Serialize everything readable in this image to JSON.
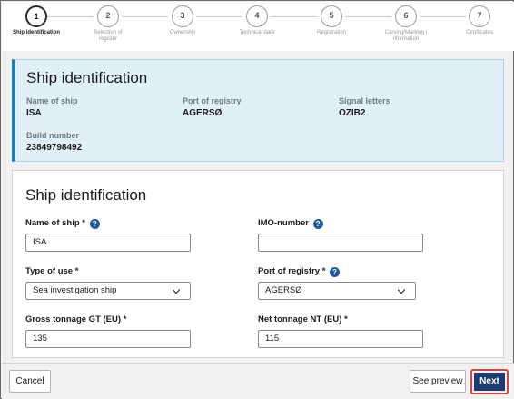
{
  "stepper": {
    "steps": [
      {
        "number": "1",
        "label": "Ship identification"
      },
      {
        "number": "2",
        "label": "Selection of register"
      },
      {
        "number": "3",
        "label": "Ownership"
      },
      {
        "number": "4",
        "label": "Technical data"
      },
      {
        "number": "5",
        "label": "Registration"
      },
      {
        "number": "6",
        "label": "Carving/Marking information"
      },
      {
        "number": "7",
        "label": "Certificates"
      }
    ]
  },
  "summary": {
    "title": "Ship identification",
    "name_label": "Name of ship",
    "name_value": "ISA",
    "port_label": "Port of registry",
    "port_value": "AGERSØ",
    "signal_label": "Signal letters",
    "signal_value": "OZIB2",
    "build_label": "Build number",
    "build_value": "23849798492"
  },
  "form": {
    "title": "Ship identification",
    "name_label": "Name of ship *",
    "name_value": "ISA",
    "imo_label": "IMO-number",
    "imo_value": "",
    "type_label": "Type of use *",
    "type_value": "Sea investigation ship",
    "port_label": "Port of registry *",
    "port_value": "AGERSØ",
    "gross_label": "Gross tonnage GT (EU) *",
    "gross_value": "135",
    "net_label": "Net tonnage NT (EU) *",
    "net_value": "115",
    "help_glyph": "?"
  },
  "footer": {
    "cancel_label": "Cancel",
    "preview_label": "See preview",
    "next_label": "Next"
  },
  "colors": {
    "accent": "#1d3c6e",
    "panel_bg": "#dff0f8",
    "panel_border": "#1f7db3",
    "highlight": "#d64545",
    "help_icon": "#1f5a9e"
  },
  "icons": [
    "help-icon",
    "chevron-down-icon"
  ]
}
